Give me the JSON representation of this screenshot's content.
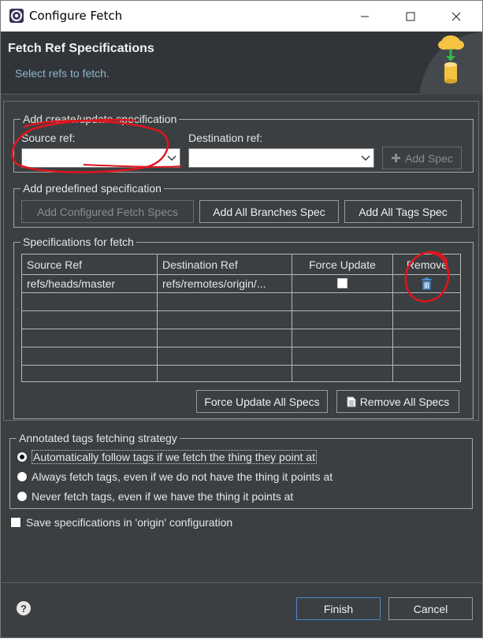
{
  "window": {
    "title": "Configure Fetch",
    "controls": [
      "minimize",
      "maximize",
      "close"
    ]
  },
  "header": {
    "title": "Fetch Ref Specifications",
    "subtitle": "Select refs to fetch."
  },
  "create_spec": {
    "group_title": "Add create/update specification",
    "source_label": "Source ref:",
    "source_value": "",
    "destination_label": "Destination ref:",
    "destination_value": "",
    "add_spec_label": "Add Spec"
  },
  "predefined": {
    "group_title": "Add predefined specification",
    "add_configured_label": "Add Configured Fetch Specs",
    "add_branches_label": "Add All Branches Spec",
    "add_tags_label": "Add All Tags Spec"
  },
  "specs": {
    "group_title": "Specifications for fetch",
    "columns": [
      "Source Ref",
      "Destination Ref",
      "Force Update",
      "Remove"
    ],
    "rows": [
      {
        "source": "refs/heads/master",
        "destination": "refs/remotes/origin/...",
        "force_update": false
      }
    ],
    "force_all_label": "Force Update All Specs",
    "remove_all_label": "Remove All Specs"
  },
  "tags_strategy": {
    "group_title": "Annotated tags fetching strategy",
    "options": [
      "Automatically follow tags if we fetch the thing they point at",
      "Always fetch tags, even if we do not have the thing it points at",
      "Never fetch tags, even if we have the thing it points at"
    ],
    "selected_index": 0
  },
  "save_config": {
    "label": "Save specifications in 'origin' configuration",
    "checked": false
  },
  "footer": {
    "finish_label": "Finish",
    "cancel_label": "Cancel"
  },
  "colors": {
    "dialog_bg": "#3b3f41",
    "header_bg": "#31353a",
    "subtitle": "#8fb6c9",
    "annotation": "#e0141e",
    "remove_icon": "#4a90d9"
  },
  "icons": [
    "app-icon",
    "chevron-down-icon",
    "plus-icon",
    "trash-icon",
    "document-icon",
    "help-icon",
    "cloud-download-icon"
  ]
}
